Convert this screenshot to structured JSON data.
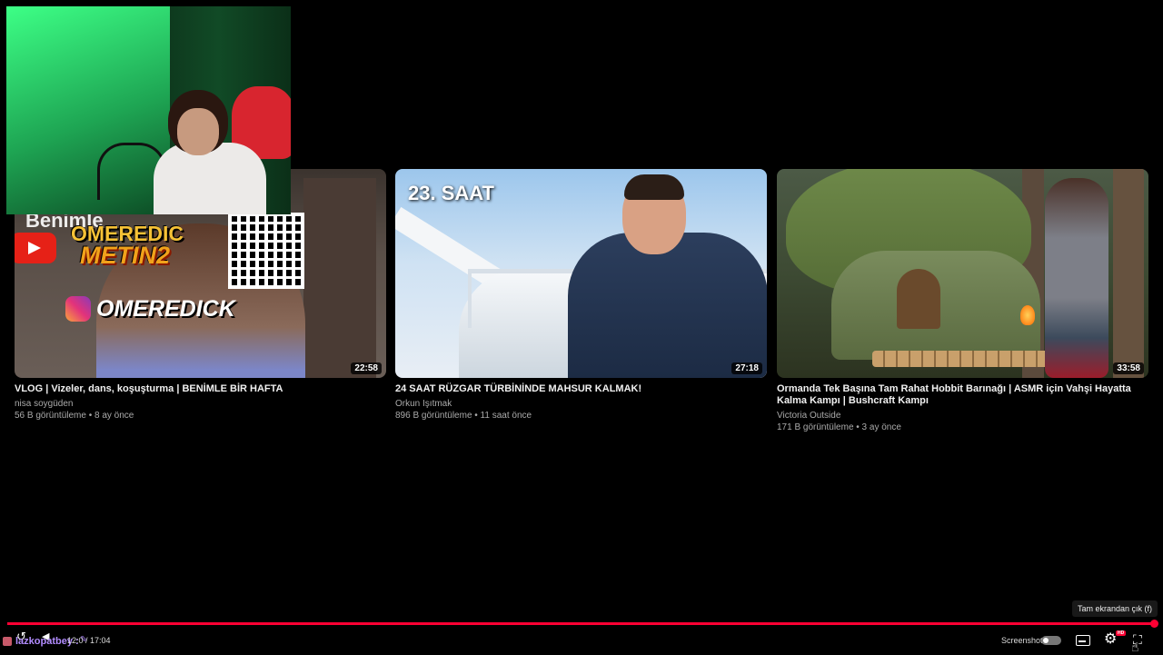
{
  "videos": [
    {
      "title": "VLOG | Vizeler, dans, koşuşturma | BENİMLE BİR HAFTA",
      "channel": "nisa soygüden",
      "meta": "56 B görüntüleme • 8 ay önce",
      "duration": "22:58",
      "thumb_text": {
        "top": "Benimle",
        "brand_line1": "OMEREDIC",
        "brand_line2": "METIN2",
        "handle": "OMEREDICK"
      }
    },
    {
      "title": "24 SAAT RÜZGAR TÜRBİNİNDE MAHSUR KALMAK!",
      "channel": "Orkun Işıtmak",
      "meta": "896 B görüntüleme • 11 saat önce",
      "duration": "27:18",
      "thumb_text": {
        "label": "23. SAAT"
      }
    },
    {
      "title": "Ormanda Tek Başına Tam Rahat Hobbit Barınağı | ASMR için Vahşi Hayatta Kalma Kampı | Bushcraft Kampı",
      "channel": "Victoria Outside",
      "meta": "171 B görüntüleme • 3 ay önce",
      "duration": "33:58"
    }
  ],
  "player": {
    "viewer_name": "lazkopatbey",
    "viewer_sep": ":",
    "time": "12:0 / 17:04",
    "screenshot_label": "Screenshot",
    "tooltip": "Tam ekrandan çık (f)",
    "progress_fraction": 0.998,
    "accent_color": "#ff0033",
    "hd_badge": "HD",
    "icons": {
      "replay": "↺",
      "volume": "◀",
      "pin": "✎",
      "gear": "⚙",
      "exit_fullscreen": "⛶",
      "cursor": "☝"
    }
  }
}
